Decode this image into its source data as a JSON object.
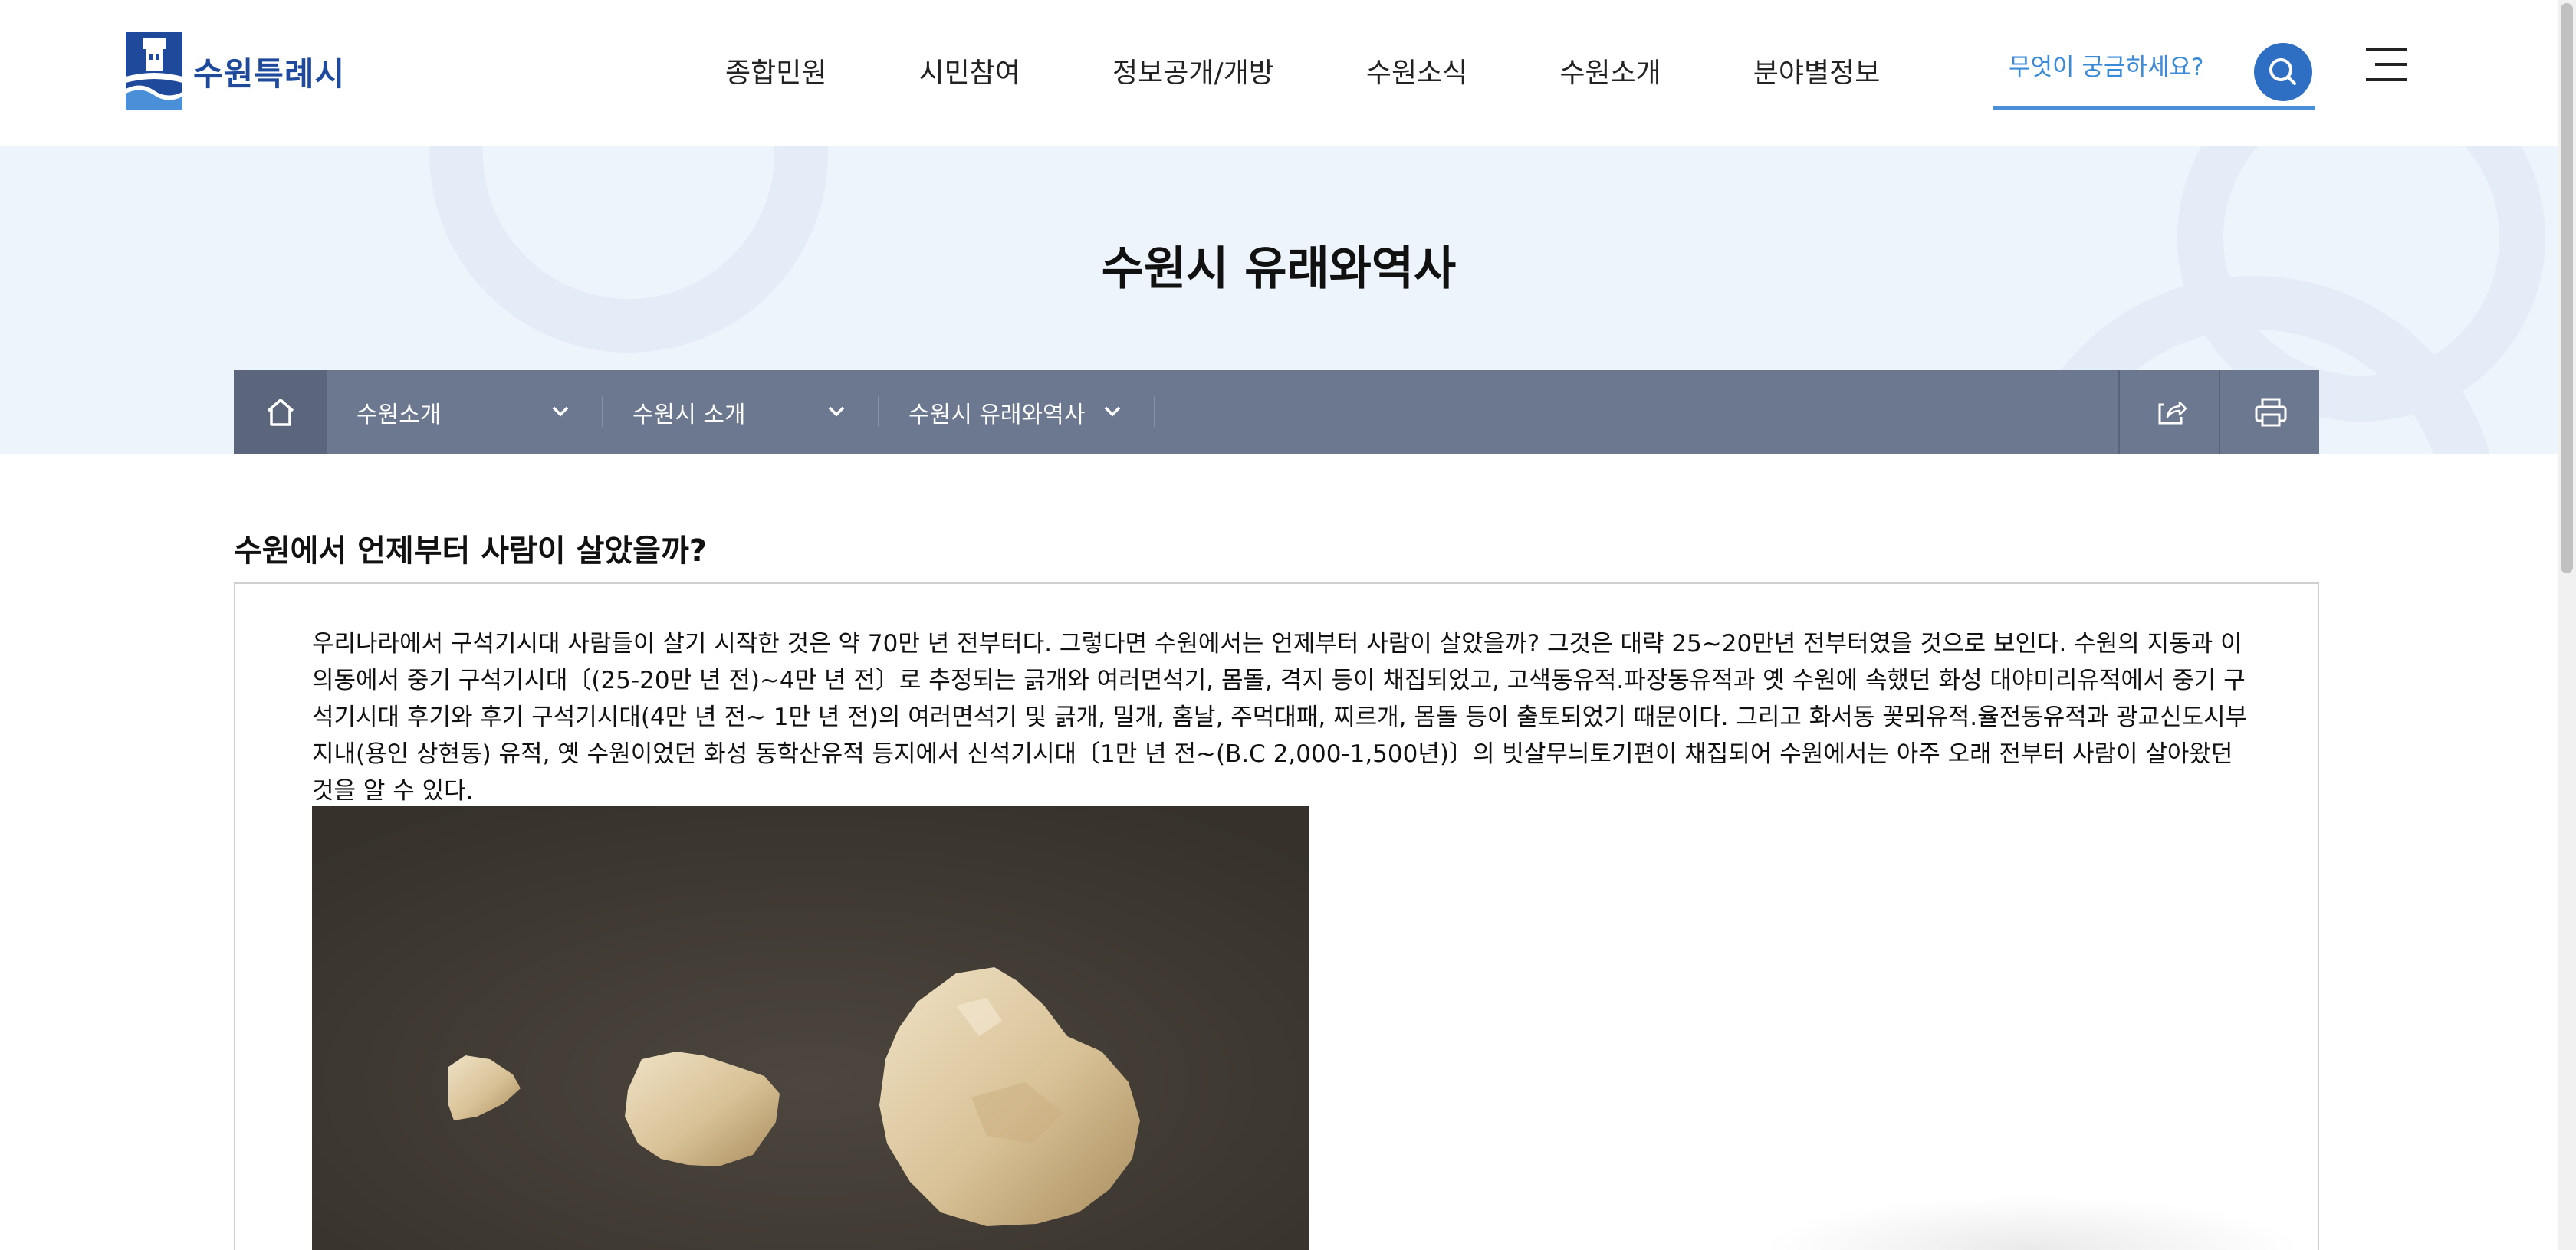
{
  "header": {
    "logo_text": "수원특례시",
    "nav": [
      "종합민원",
      "시민참여",
      "정보공개/개방",
      "수원소식",
      "수원소개",
      "분야별정보"
    ],
    "search": {
      "placeholder": "무엇이 궁금하세요?",
      "icon": "search-icon"
    },
    "menu_icon": "hamburger-icon"
  },
  "visual": {
    "page_title": "수원시 유래와역사"
  },
  "location": {
    "home_icon": "home-icon",
    "items": [
      {
        "label": "수원소개",
        "icon": "chevron-down-icon"
      },
      {
        "label": "수원시 소개",
        "icon": "chevron-down-icon"
      },
      {
        "label": "수원시 유래와역사",
        "icon": "chevron-down-icon"
      }
    ],
    "tools": [
      "share-icon",
      "print-icon"
    ]
  },
  "content": {
    "section_title": "수원에서 언제부터 사람이 살았을까?",
    "paragraph": "우리나라에서 구석기시대 사람들이 살기 시작한 것은 약 70만 년 전부터다. 그렇다면 수원에서는 언제부터 사람이 살았을까? 그것은 대략 25~20만년 전부터였을 것으로 보인다. 수원의 지동과 이의동에서 중기 구석기시대〔(25-20만 년 전)~4만 년 전〕로 추정되는 긁개와 여러면석기, 몸돌, 격지 등이 채집되었고, 고색동유적.파장동유적과 옛 수원에 속했던 화성 대야미리유적에서 중기 구석기시대 후기와 후기 구석기시대(4만 년 전~ 1만 년 전)의 여러면석기 및 긁개, 밀개, 홈날, 주먹대패, 찌르개, 몸돌 등이 출토되었기 때문이다. 그리고 화서동 꽃뫼유적.율전동유적과 광교신도시부지내(용인 상현동) 유적, 옛 수원이었던 화성 동학산유적 등지에서 신석기시대〔1만 년 전~(B.C 2,000-1,500년)〕의 빗살무늬토기편이 채집되어 수원에서는 아주 오래 전부터 사람이 살아왔던 것을 알 수 있다."
  },
  "colors": {
    "brand": "#1f4a9c",
    "search_accent": "#2e6fc4",
    "location_bar": "#6c788f",
    "visual_bg": "#eef4fb"
  }
}
